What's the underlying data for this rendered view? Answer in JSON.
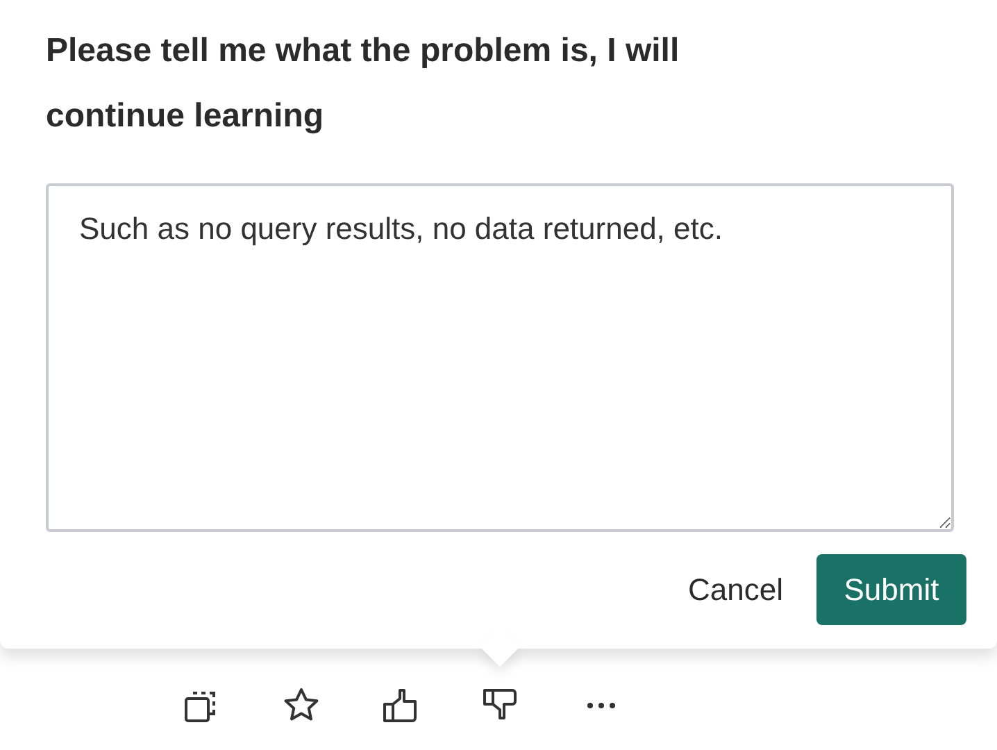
{
  "feedback": {
    "title": "Please tell me what the problem is, I will continue learning",
    "placeholder": "Such as no query results, no data returned, etc.",
    "cancel": "Cancel",
    "submit": "Submit"
  }
}
